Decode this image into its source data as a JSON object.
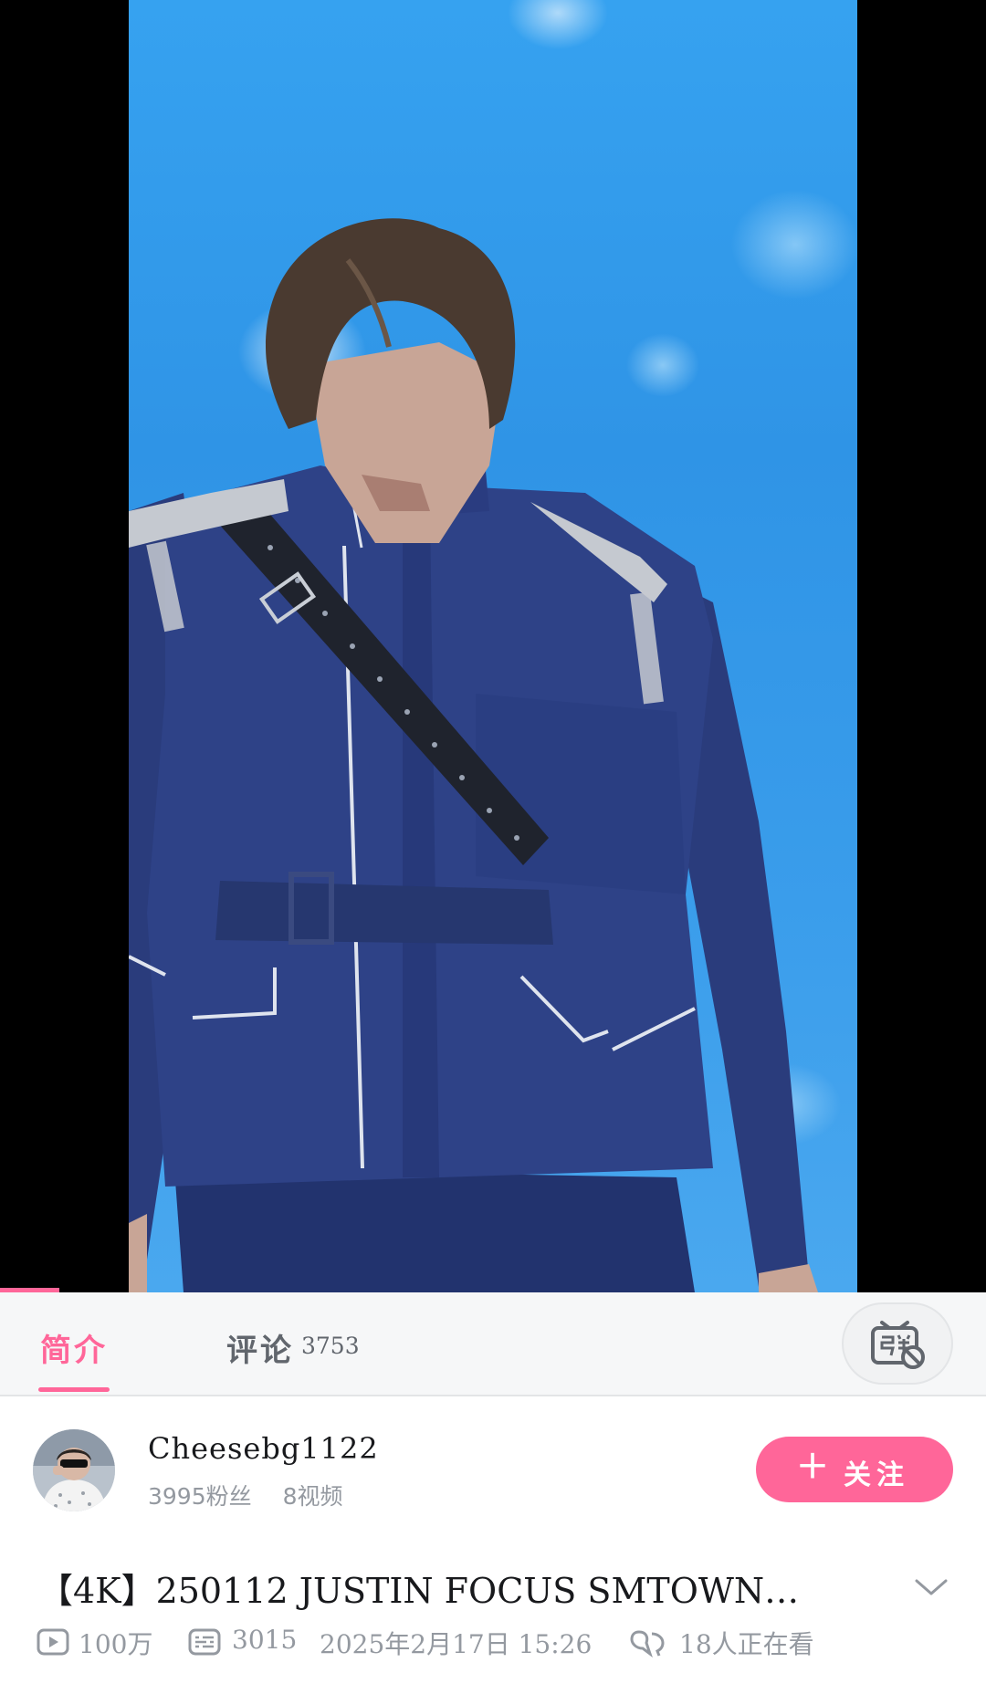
{
  "video": {
    "progress_fraction": 0.06
  },
  "tabs": {
    "intro_label": "简介",
    "comments_label": "评论",
    "comments_count": "3753",
    "danmaku_toggle_icon": "danmaku-off-icon"
  },
  "uploader": {
    "name": "Cheesebg1122",
    "fans": "3995粉丝",
    "videos": "8视频",
    "follow_label": "关注"
  },
  "video_info": {
    "title": "【4K】250112 JUSTIN FOCUS SMTOWN…",
    "views": "100万",
    "danmaku_count": "3015",
    "publish_time": "2025年2月17日 15:26",
    "watching_now": "18人正在看"
  },
  "colors": {
    "accent": "#ff6699",
    "secondary_text": "#9499a0"
  }
}
